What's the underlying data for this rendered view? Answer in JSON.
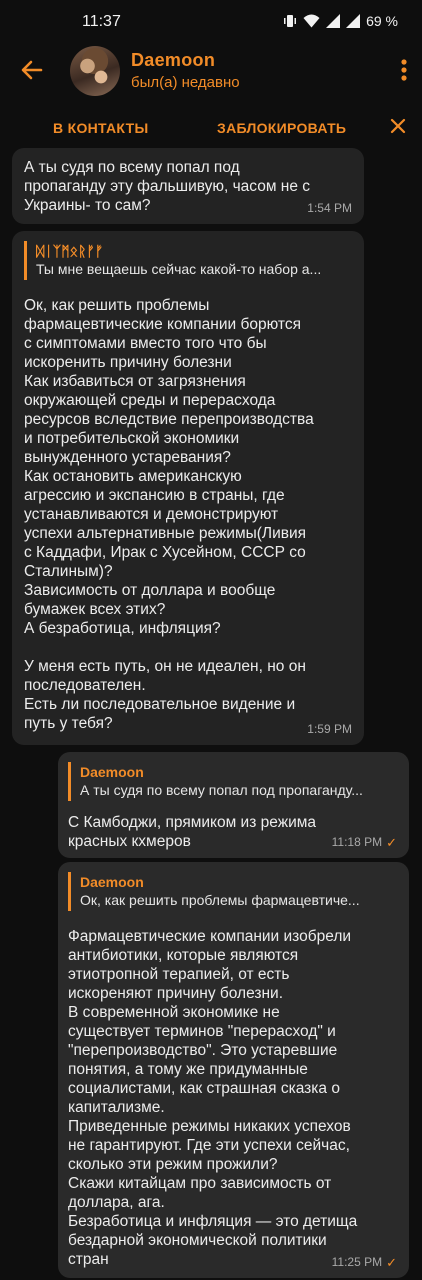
{
  "status_bar": {
    "time": "11:37",
    "battery": "69 %"
  },
  "header": {
    "contact_name": "Daemoon",
    "contact_status": "был(а) недавно"
  },
  "actions": {
    "add_contact": "В КОНТАКТЫ",
    "block": "ЗАБЛОКИРОВАТЬ"
  },
  "messages": [
    {
      "direction": "incoming",
      "text": "А ты судя по всему попал под\nпропаганду эту фальшивую, часом не с\nУкраины- то сам?",
      "time": "1:54 PM"
    },
    {
      "direction": "incoming",
      "reply_name": "ᛞᛁᛉᛗᛟᚱᚠᚠ",
      "reply_text": "Ты мне вещаешь сейчас какой-то набор а...",
      "text": "Ок, как решить проблемы\nфармацевтические компании борются\nс симптомами вместо того что бы\nискоренить причину болезни\nКак избавиться от загрязнения\nокружающей среды и перерасхода\nресурсов вследствие перепроизводства\nи потребительской экономики\nвынужденного устаревания?\nКак остановить американскую\nагрессию и экспансию в страны, где\nустанавливаются и демонстрируют\nуспехи альтернативные режимы(Ливия\nс Каддафи, Ирак с Хусейном, СССР со\nСталиным)?\nЗависимость от доллара и вообще\nбумажек всех этих?\nА безработица, инфляция?\n\nУ меня есть путь, он не идеален, но он\nпоследователен.\nЕсть ли последовательное видение и\nпуть у тебя?",
      "time": "1:59 PM"
    },
    {
      "direction": "outgoing",
      "reply_name": "Daemoon",
      "reply_text": "А ты судя по всему попал под пропаганду...",
      "text": "С Камбоджи, прямиком из режима\nкрасных кхмеров",
      "time": "11:18 PM"
    },
    {
      "direction": "outgoing",
      "reply_name": "Daemoon",
      "reply_text": "Ок, как решить проблемы  фармацевтиче...",
      "text": "Фармацевтические компании изобрели\nантибиотики, которые являются\nэтиотропной терапией, от есть\nискореняют причину болезни.\nВ современной экономике не\nсуществует терминов \"перерасход\" и\n\"перепроизводство\". Это устаревшие\nпонятия, а тому же придуманные\nсоциалистами, как страшная сказка о\nкапитализме.\nПриведенные режимы никаких успехов\nне гарантируют. Где эти успехи сейчас,\nсколько эти режим прожили?\nСкажи китайцам про зависимость от\nдоллара, ага.\nБезработица и инфляция — это детища\nбездарной экономической политики\nстран",
      "time": "11:25 PM"
    }
  ],
  "colors": {
    "accent": "#f28c28",
    "background": "#0e0e0e",
    "bubble": "#232323"
  }
}
